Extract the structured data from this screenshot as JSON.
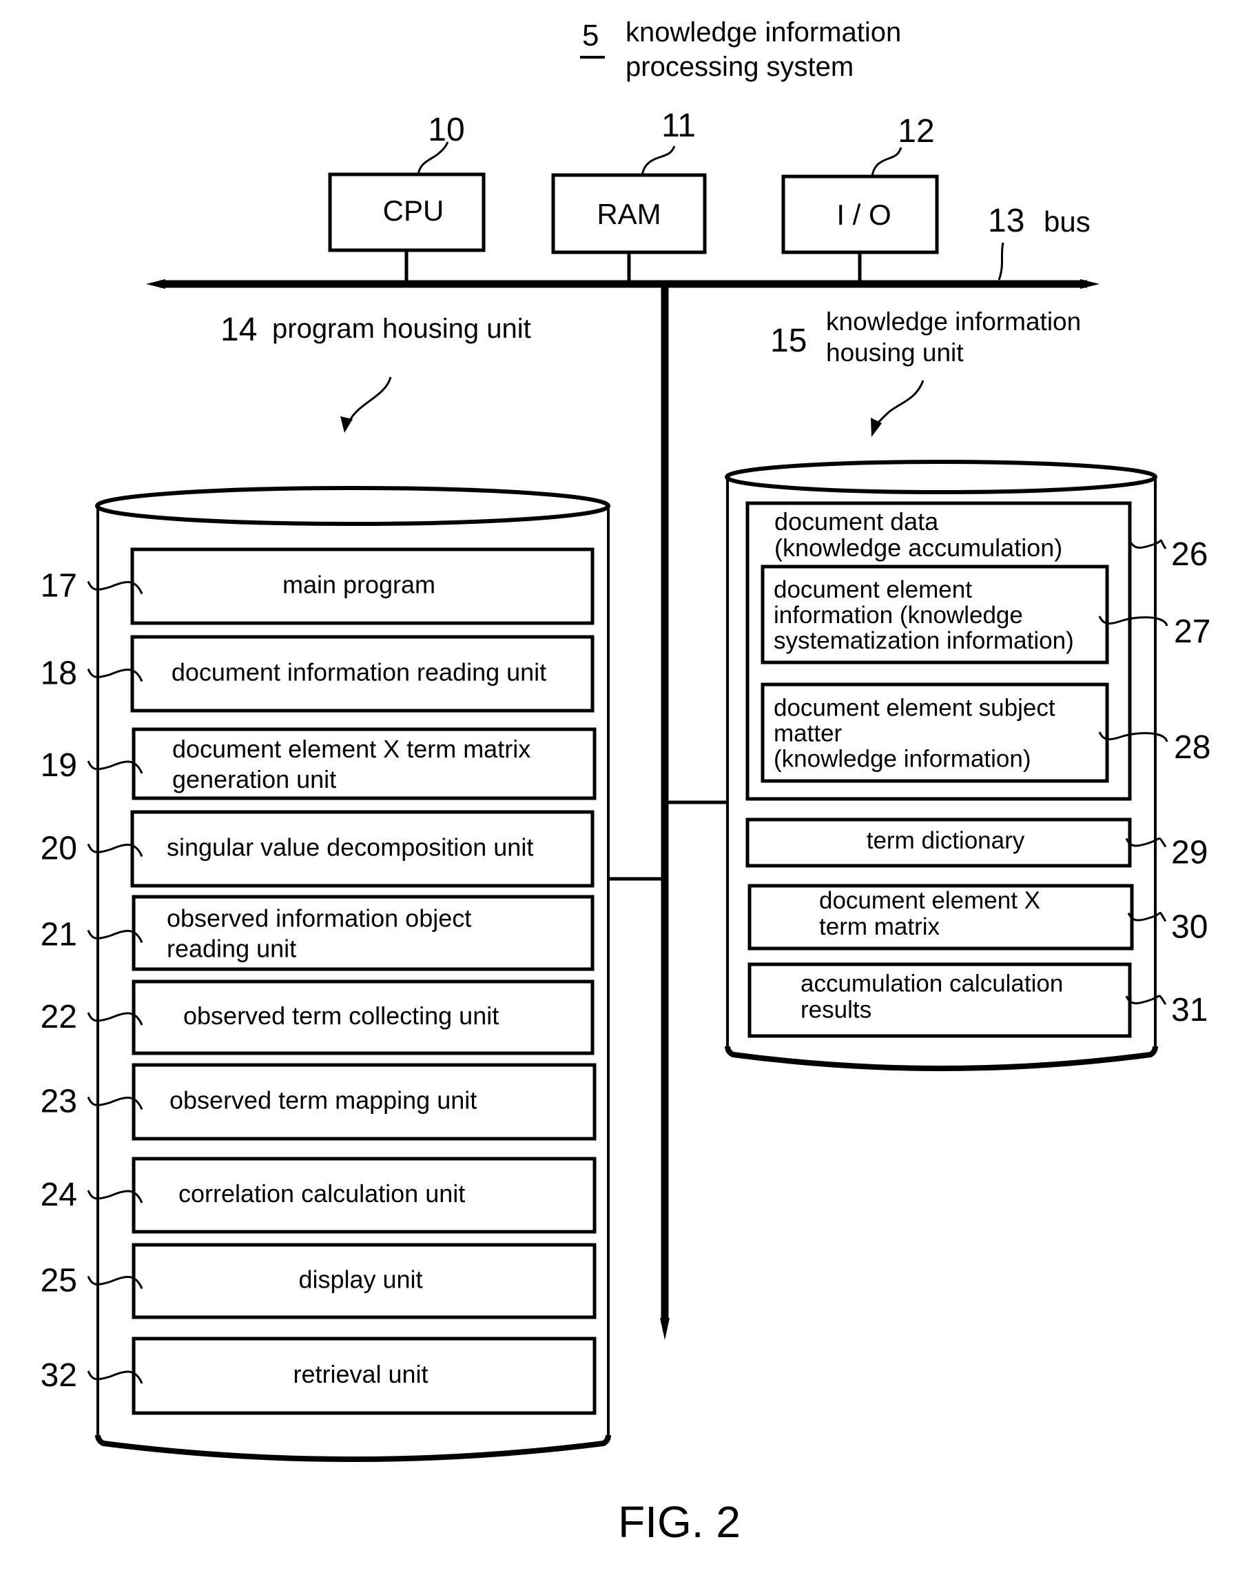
{
  "system": {
    "ref": "5",
    "label_line1": "knowledge information",
    "label_line2": "processing system"
  },
  "hardware": [
    {
      "ref": "10",
      "label": "CPU"
    },
    {
      "ref": "11",
      "label": "RAM"
    },
    {
      "ref": "12",
      "label": "I / O"
    }
  ],
  "bus": {
    "ref": "13",
    "label": "bus"
  },
  "program_housing": {
    "ref": "14",
    "label": "program housing unit",
    "units": [
      {
        "ref": "17",
        "lines": [
          "main program"
        ]
      },
      {
        "ref": "18",
        "lines": [
          "document information reading unit"
        ]
      },
      {
        "ref": "19",
        "lines": [
          "document element X term matrix",
          "generation unit"
        ]
      },
      {
        "ref": "20",
        "lines": [
          "singular value decomposition unit"
        ]
      },
      {
        "ref": "21",
        "lines": [
          "observed information object",
          "reading unit"
        ]
      },
      {
        "ref": "22",
        "lines": [
          "observed term collecting unit"
        ]
      },
      {
        "ref": "23",
        "lines": [
          "observed term mapping unit"
        ]
      },
      {
        "ref": "24",
        "lines": [
          "correlation calculation unit"
        ]
      },
      {
        "ref": "25",
        "lines": [
          "display unit"
        ]
      },
      {
        "ref": "32",
        "lines": [
          "retrieval unit"
        ]
      }
    ]
  },
  "knowledge_housing": {
    "ref": "15",
    "label_line1": "knowledge information",
    "label_line2": "housing unit",
    "document_data": {
      "ref": "26",
      "lines": [
        "document data",
        "(knowledge accumulation)"
      ],
      "children": [
        {
          "ref": "27",
          "lines": [
            "document element",
            "information (knowledge",
            "systematization information)"
          ]
        },
        {
          "ref": "28",
          "lines": [
            "document element subject",
            "matter",
            "(knowledge information)"
          ]
        }
      ]
    },
    "items": [
      {
        "ref": "29",
        "lines": [
          "term dictionary"
        ]
      },
      {
        "ref": "30",
        "lines": [
          "document element X",
          "term matrix"
        ]
      },
      {
        "ref": "31",
        "lines": [
          "accumulation calculation",
          "results"
        ]
      }
    ]
  },
  "figure_caption": "FIG. 2"
}
